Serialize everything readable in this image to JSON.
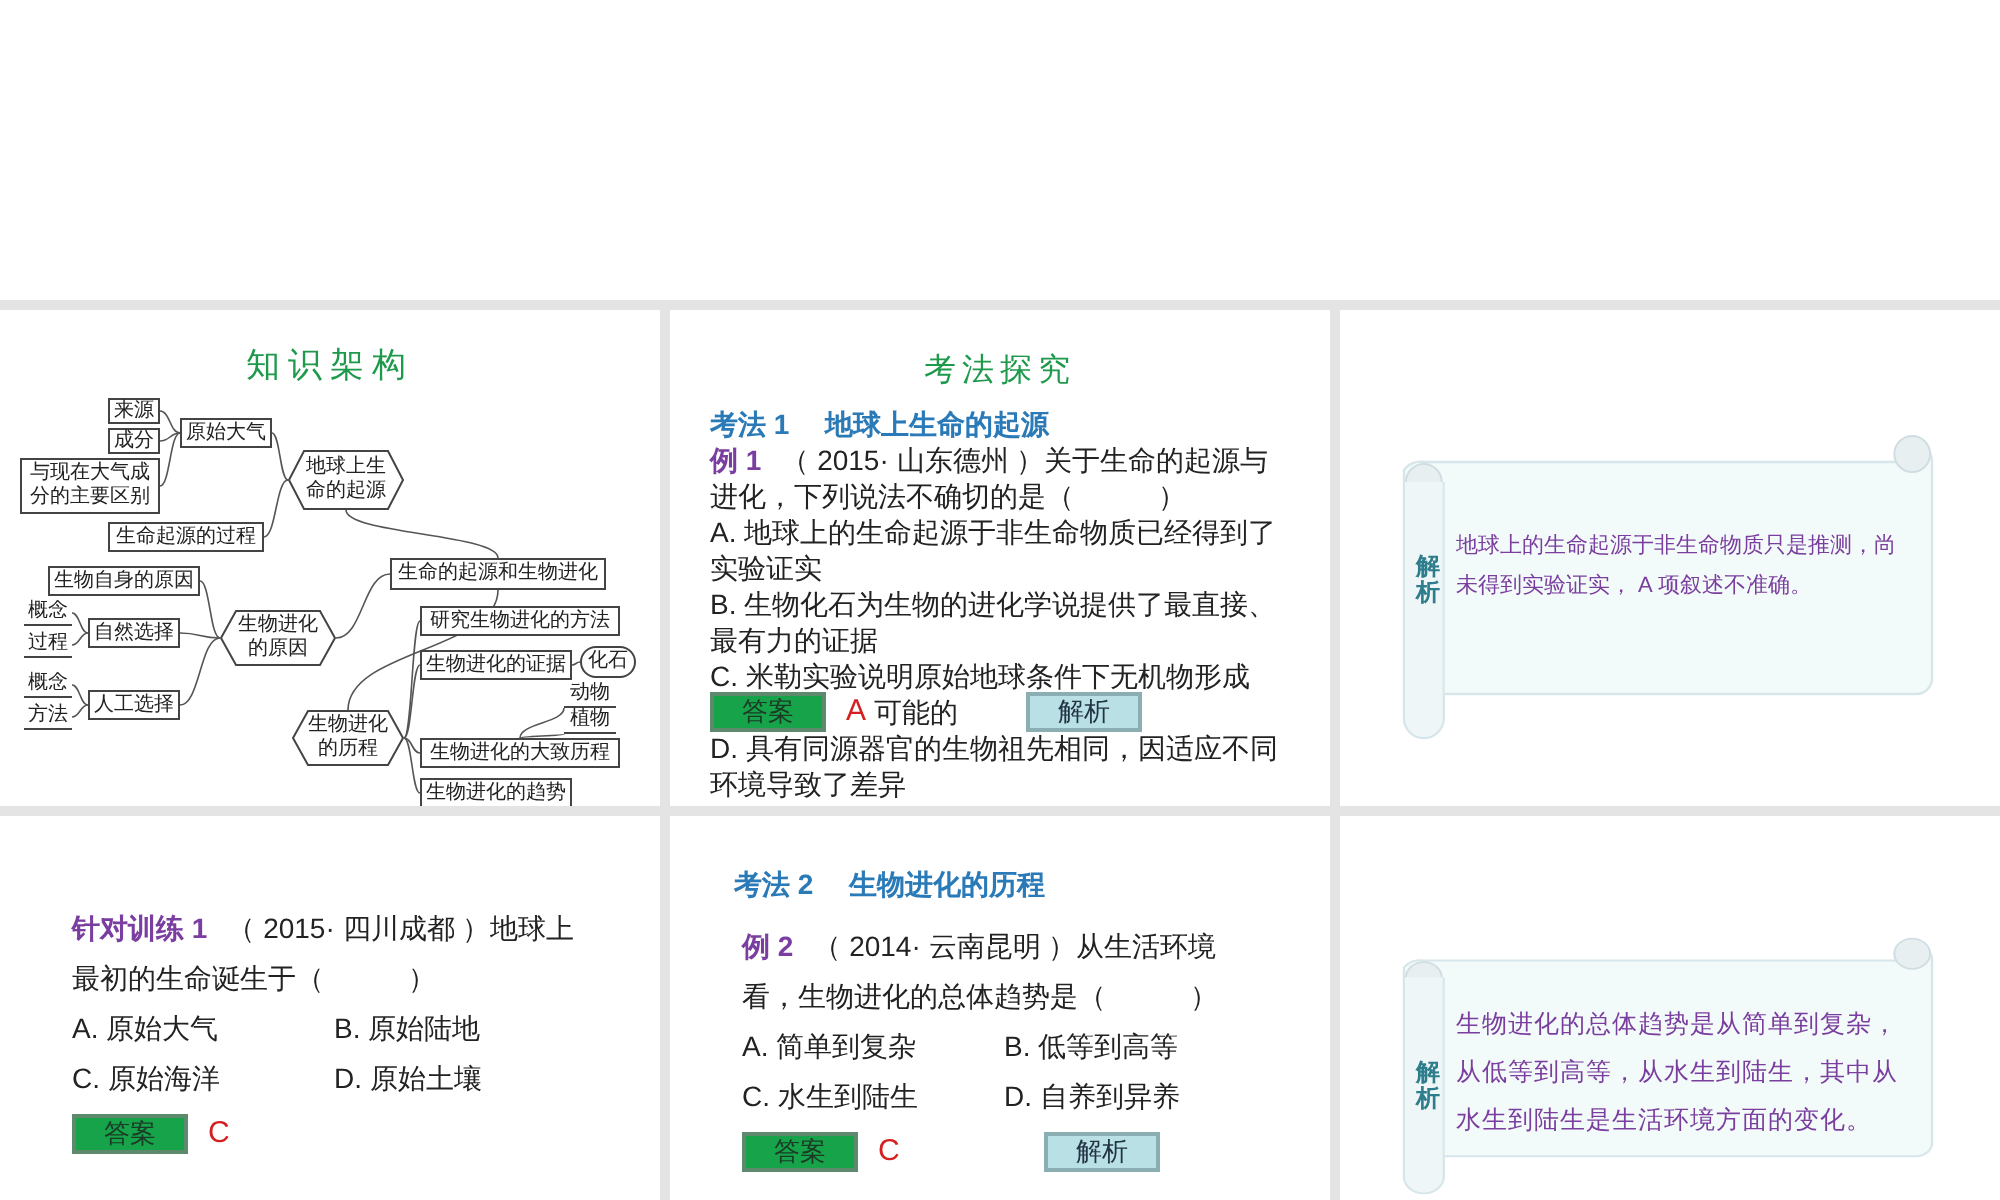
{
  "slides": [
    {
      "kind": "mindmap",
      "title": "知识架构",
      "tree": {
        "label": "生命的起源和生物进化",
        "kind": "box",
        "children": [
          {
            "label": "地球上生命的起源",
            "kind": "hexagon",
            "children": [
              {
                "label": "原始大气",
                "kind": "box",
                "children": [
                  {
                    "label": "来源",
                    "kind": "box"
                  },
                  {
                    "label": "成分",
                    "kind": "box"
                  },
                  {
                    "label": "与现在大气成分的主要区别",
                    "kind": "box"
                  }
                ]
              },
              {
                "label": "生命起源的过程",
                "kind": "box"
              }
            ]
          },
          {
            "label": "生物进化的原因",
            "kind": "hexagon",
            "children": [
              {
                "label": "生物自身的原因",
                "kind": "box"
              },
              {
                "label": "自然选择",
                "kind": "box",
                "children": [
                  {
                    "label": "概念",
                    "kind": "label"
                  },
                  {
                    "label": "过程",
                    "kind": "label"
                  }
                ]
              },
              {
                "label": "人工选择",
                "kind": "box",
                "children": [
                  {
                    "label": "概念",
                    "kind": "label"
                  },
                  {
                    "label": "方法",
                    "kind": "label"
                  }
                ]
              }
            ]
          },
          {
            "label": "生物进化的历程",
            "kind": "hexagon",
            "children": [
              {
                "label": "研究生物进化的方法",
                "kind": "box"
              },
              {
                "label": "生物进化的证据",
                "kind": "box",
                "children": [
                  {
                    "label": "化石",
                    "kind": "cloud"
                  }
                ]
              },
              {
                "label": "生物进化的大致历程",
                "kind": "box",
                "children": [
                  {
                    "label": "动物",
                    "kind": "label"
                  },
                  {
                    "label": "植物",
                    "kind": "label"
                  }
                ]
              },
              {
                "label": "生物进化的趋势",
                "kind": "box"
              }
            ]
          }
        ]
      }
    },
    {
      "kind": "question",
      "title": "考法探究",
      "body": [
        {
          "kind": "section",
          "text": "考法 1　 地球上生命的起源"
        },
        {
          "kind": "stem",
          "tag": "例 1",
          "text": "（ 2015· 山东德州 ）关于生命的起源与进化，下列说法不确切的是（　　　）"
        },
        {
          "kind": "option",
          "text": "A. 地球上的生命起源于非生命物质已经得到了实验证实"
        },
        {
          "kind": "option",
          "text": "B. 生物化石为生物的进化学说提供了最直接、最有力的证据"
        },
        {
          "kind": "option",
          "text": "C. 米勒实验说明原始地球条件下无机物形成"
        },
        {
          "kind": "actions",
          "answer": "A",
          "trailing": "可能的",
          "buttons": [
            {
              "label": "答案",
              "kind": "answer"
            },
            {
              "label": "解析",
              "kind": "analysis"
            }
          ]
        },
        {
          "kind": "option",
          "text": "D. 具有同源器官的生物祖先相同，因适应不同环境导致了差异"
        }
      ]
    },
    {
      "kind": "analysis",
      "label": "解析",
      "text": "地球上的生命起源于非生命物质只是推测，尚未得到实验证实， A 项叙述不准确。"
    },
    {
      "kind": "question",
      "body": [
        {
          "kind": "stem",
          "tag": "针对训练 1",
          "text": "（ 2015· 四川成都 ）地球上最初的生命诞生于（　　　）"
        },
        {
          "kind": "option_grid",
          "options": [
            "A. 原始大气",
            "B. 原始陆地",
            "C. 原始海洋",
            "D. 原始土壤"
          ]
        },
        {
          "kind": "actions",
          "answer": "C",
          "buttons": [
            {
              "label": "答案",
              "kind": "answer"
            }
          ]
        }
      ]
    },
    {
      "kind": "question",
      "body": [
        {
          "kind": "section",
          "text": "考法 2　 生物进化的历程"
        },
        {
          "kind": "stem",
          "tag": "例 2",
          "text": "（ 2014· 云南昆明 ）从生活环境看，生物进化的总体趋势是（　　　）"
        },
        {
          "kind": "option_grid",
          "options": [
            "A. 简单到复杂",
            "B. 低等到高等",
            "C. 水生到陆生",
            "D. 自养到异养"
          ]
        },
        {
          "kind": "actions",
          "answer": "C",
          "buttons": [
            {
              "label": "答案",
              "kind": "answer"
            },
            {
              "label": "解析",
              "kind": "analysis"
            }
          ]
        }
      ]
    },
    {
      "kind": "analysis",
      "label": "解析",
      "text": "生物进化的总体趋势是从简单到复杂，从低等到高等，从水生到陆生，其中从水生到陆生是生活环境方面的变化。"
    }
  ]
}
